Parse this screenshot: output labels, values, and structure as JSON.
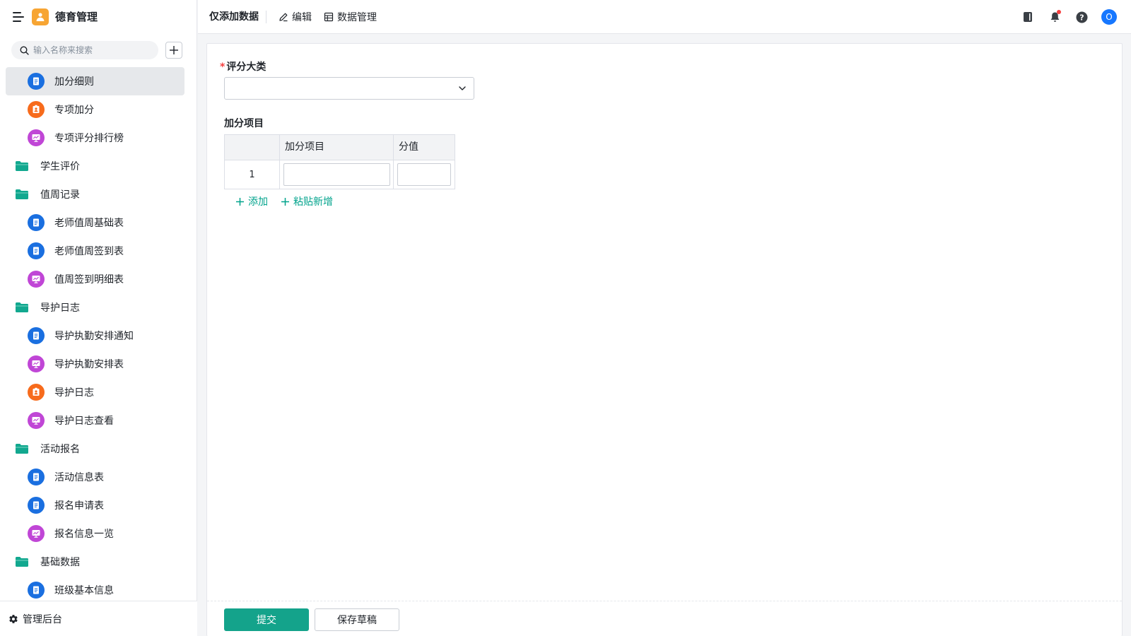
{
  "app": {
    "title": "德育管理",
    "logo_color": "#f7a533"
  },
  "search": {
    "placeholder": "输入名称来搜索"
  },
  "sidebar": {
    "items": [
      {
        "type": "form",
        "label": "加分细则",
        "icon": "form-icon",
        "color": "#1a6fe0",
        "active": true
      },
      {
        "type": "sheet",
        "label": "专项加分",
        "icon": "sheet-icon",
        "color": "#f76b1c"
      },
      {
        "type": "report",
        "label": "专项评分排行榜",
        "icon": "report-icon",
        "color": "#c046d6"
      },
      {
        "type": "folder",
        "label": "学生评价",
        "icon": "folder-icon",
        "color": "#12a88f"
      },
      {
        "type": "folder",
        "label": "值周记录",
        "icon": "folder-open-icon",
        "color": "#12a88f"
      },
      {
        "type": "form",
        "label": "老师值周基础表",
        "icon": "form-icon",
        "color": "#1a6fe0"
      },
      {
        "type": "form",
        "label": "老师值周签到表",
        "icon": "form-icon",
        "color": "#1a6fe0"
      },
      {
        "type": "report",
        "label": "值周签到明细表",
        "icon": "report-icon",
        "color": "#c046d6"
      },
      {
        "type": "folder",
        "label": "导护日志",
        "icon": "folder-open-icon",
        "color": "#12a88f"
      },
      {
        "type": "form",
        "label": "导护执勤安排通知",
        "icon": "form-icon",
        "color": "#1a6fe0"
      },
      {
        "type": "report",
        "label": "导护执勤安排表",
        "icon": "report-icon",
        "color": "#c046d6"
      },
      {
        "type": "sheet",
        "label": "导护日志",
        "icon": "sheet-icon",
        "color": "#f76b1c"
      },
      {
        "type": "report",
        "label": "导护日志查看",
        "icon": "report-icon",
        "color": "#c046d6"
      },
      {
        "type": "folder",
        "label": "活动报名",
        "icon": "folder-open-icon",
        "color": "#12a88f"
      },
      {
        "type": "form",
        "label": "活动信息表",
        "icon": "form-icon",
        "color": "#1a6fe0"
      },
      {
        "type": "form",
        "label": "报名申请表",
        "icon": "form-icon",
        "color": "#1a6fe0"
      },
      {
        "type": "report",
        "label": "报名信息一览",
        "icon": "report-icon",
        "color": "#c046d6"
      },
      {
        "type": "folder",
        "label": "基础数据",
        "icon": "folder-open-icon",
        "color": "#12a88f"
      },
      {
        "type": "form",
        "label": "班级基本信息",
        "icon": "form-icon",
        "color": "#1a6fe0"
      }
    ],
    "footer_label": "管理后台"
  },
  "topbar": {
    "title": "仅添加数据",
    "edit_label": "编辑",
    "data_manage_label": "数据管理",
    "avatar_letter": "O"
  },
  "form": {
    "category_label": "评分大类",
    "category_value": "",
    "items_label": "加分项目",
    "table": {
      "headers": [
        "",
        "加分项目",
        "分值"
      ],
      "rows": [
        {
          "index": "1",
          "item": "",
          "score": ""
        }
      ]
    },
    "add_label": "添加",
    "paste_add_label": "粘贴新增",
    "submit_label": "提交",
    "draft_label": "保存草稿"
  },
  "colors": {
    "accent": "#14a38b",
    "link": "#00a38c",
    "required": "#f53f3f"
  }
}
